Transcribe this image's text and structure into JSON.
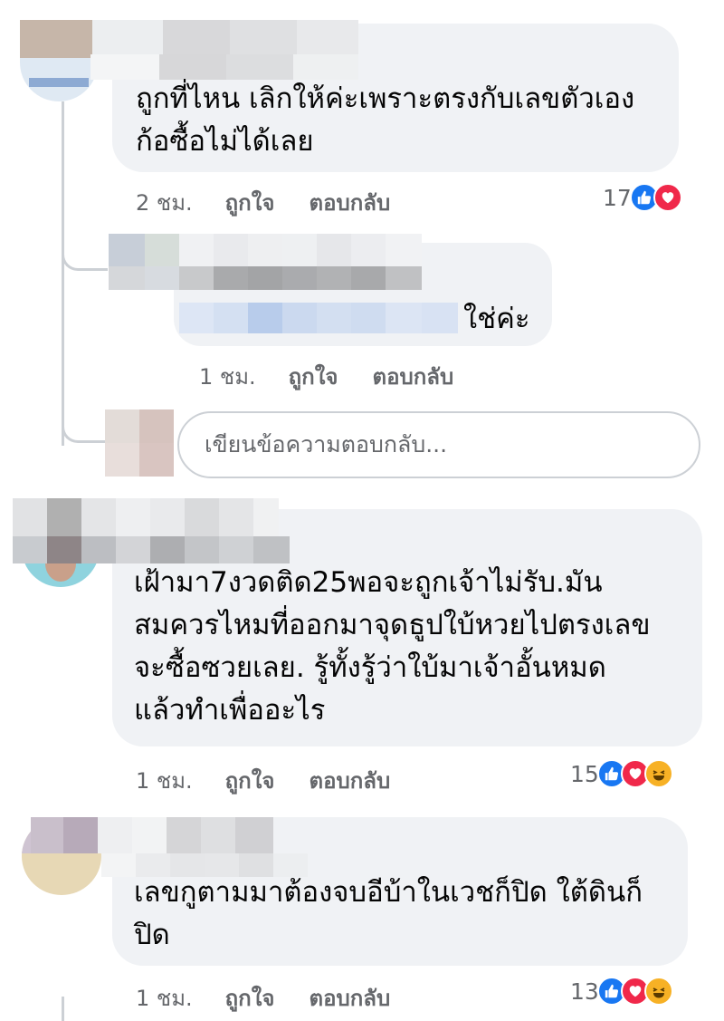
{
  "comments": [
    {
      "text": "ถูกที่ไหน เลิกให้ค่ะเพราะตรงกับเลขตัวเอง\nก้อซื้อไม่ได้เลย",
      "time": "2 ชม.",
      "like_label": "ถูกใจ",
      "reply_label": "ตอบกลับ",
      "reaction_count": "17",
      "reactions": [
        "like-icon",
        "love-icon"
      ]
    },
    {
      "text": "เฝ้ามา7งวดติด25พอจะถูกเจ้าไม่รับ.มัน\nสมควรไหมที่ออกมาจุดธูปใบ้หวยไปตรงเลข\nจะซื้อซวยเลย.  รู้ทั้งรู้ว่าใบ้มาเจ้าอั้นหมด\nแล้วทำเพื่ออะไร",
      "time": "1 ชม.",
      "like_label": "ถูกใจ",
      "reply_label": "ตอบกลับ",
      "reaction_count": "15",
      "reactions": [
        "like-icon",
        "love-icon",
        "haha-icon"
      ]
    },
    {
      "text": "เลขกูตามมาต้องจบอีบ้าในเวชก็ปิด ใต้ดินก็\nปิด",
      "time": "1 ชม.",
      "like_label": "ถูกใจ",
      "reply_label": "ตอบกลับ",
      "reaction_count": "13",
      "reactions": [
        "like-icon",
        "love-icon",
        "haha-icon"
      ]
    }
  ],
  "reply": {
    "text": "ใช่ค่ะ",
    "time": "1 ชม.",
    "like_label": "ถูกใจ",
    "reply_label": "ตอบกลับ"
  },
  "reply_input": {
    "placeholder": "เขียนข้อความตอบกลับ..."
  },
  "colors": {
    "bubble": "#f0f2f5",
    "meta_text": "#65676b",
    "like": "#1877f2",
    "love": "#f0284a",
    "haha": "#f7b125"
  }
}
